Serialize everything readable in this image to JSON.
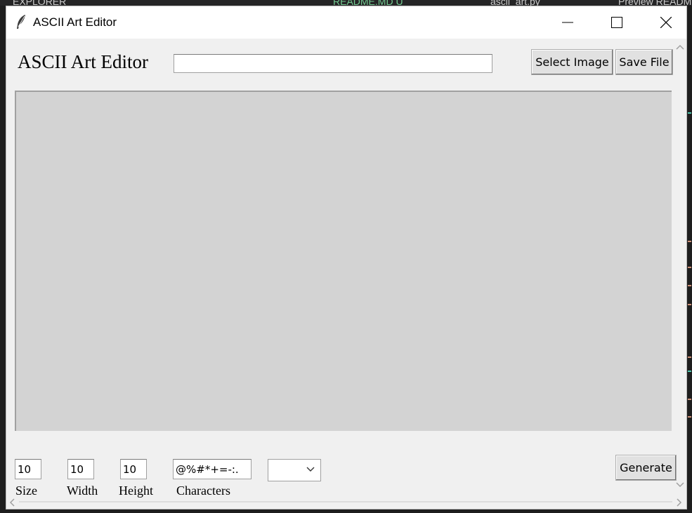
{
  "background": {
    "tabs": [
      "EXPLORER",
      "README.MD U",
      "ascii_art.py",
      "Preview README"
    ],
    "colors": {
      "editor_bg": "#1e1e1e",
      "tab_bg": "#252526",
      "readme_tab": "#73c991"
    }
  },
  "window": {
    "title": "ASCII Art Editor",
    "icon": "feather-icon",
    "controls": [
      "minimize-icon",
      "maximize-icon",
      "close-icon"
    ]
  },
  "header": {
    "heading": "ASCII Art Editor",
    "path_value": "",
    "select_image_label": "Select Image",
    "save_file_label": "Save File"
  },
  "canvas": {
    "color": "#d3d3d3"
  },
  "controls": {
    "size": {
      "value": "10",
      "label": "Size"
    },
    "width": {
      "value": "10",
      "label": "Width"
    },
    "height": {
      "value": "10",
      "label": "Height"
    },
    "characters": {
      "value": "@%#*+=-:.",
      "label": "Characters"
    },
    "option_value": "",
    "generate_label": "Generate"
  },
  "scrollbars": [
    "chevron-up-icon",
    "chevron-down-icon",
    "chevron-left-icon",
    "chevron-right-icon"
  ]
}
